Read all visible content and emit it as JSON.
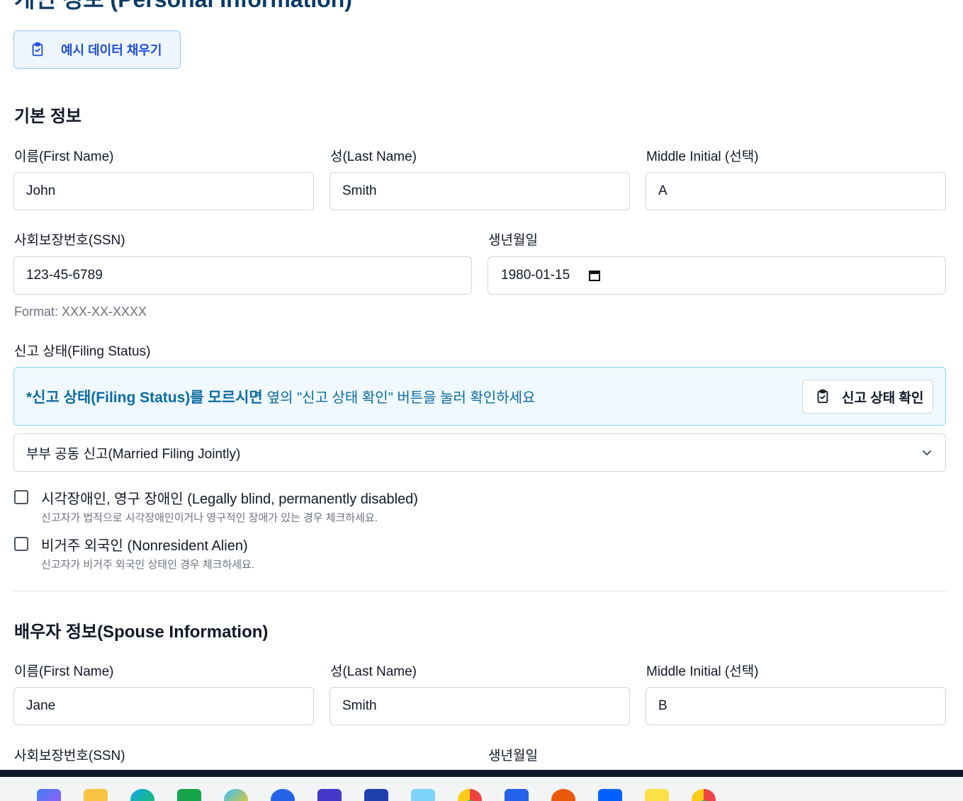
{
  "page": {
    "title": "개인 정보 (Personal Information)",
    "example_button": "예시 데이터 채우기"
  },
  "basic": {
    "section_title": "기본 정보",
    "first_name_label": "이름(First Name)",
    "first_name_value": "John",
    "last_name_label": "성(Last Name)",
    "last_name_value": "Smith",
    "middle_label": "Middle Initial (선택)",
    "middle_value": "A",
    "ssn_label": "사회보장번호(SSN)",
    "ssn_value": "123-45-6789",
    "ssn_hint": "Format: XXX-XX-XXXX",
    "dob_label": "생년월일",
    "dob_value": "1980-01-15"
  },
  "filing": {
    "label": "신고 상태(Filing Status)",
    "info_strong": "*신고 상태(Filing Status)를 모르시면",
    "info_rest": "옆의 \"신고 상태 확인\" 버튼을 눌러 확인하세요",
    "check_button": "신고 상태 확인",
    "selected_status": "부부 공동 신고(Married Filing Jointly)"
  },
  "checks": [
    {
      "label": "시각장애인, 영구 장애인 (Legally blind, permanently disabled)",
      "desc": "신고자가 법적으로 시각장애인이거나 영구적인 장애가 있는 경우 체크하세요.",
      "checked": false
    },
    {
      "label": "비거주 외국인 (Nonresident Alien)",
      "desc": "신고자가 비거주 외국인 상태인 경우 체크하세요.",
      "checked": false
    }
  ],
  "spouse": {
    "section_title": "배우자 정보(Spouse Information)",
    "first_name_label": "이름(First Name)",
    "first_name_value": "Jane",
    "last_name_label": "성(Last Name)",
    "last_name_value": "Smith",
    "middle_label": "Middle Initial (선택)",
    "middle_value": "B",
    "ssn_label": "사회보장번호(SSN)",
    "dob_label": "생년월일"
  },
  "icons": {
    "clipboard": "clipboard-check-icon",
    "calendar": "calendar-icon",
    "chevron": "chevron-down-icon"
  },
  "colors": {
    "accent_blue": "#1d4ed8",
    "info_text": "#0c6ba1",
    "info_bg": "#f0f9ff"
  },
  "taskbar": {
    "apps": [
      "copilot",
      "file-explorer",
      "edge",
      "excel",
      "photos",
      "zoom",
      "visual-studio",
      "store",
      "notepad",
      "chrome",
      "word",
      "powerpoint",
      "dropbox",
      "kakaotalk",
      "chrome-profile"
    ]
  }
}
